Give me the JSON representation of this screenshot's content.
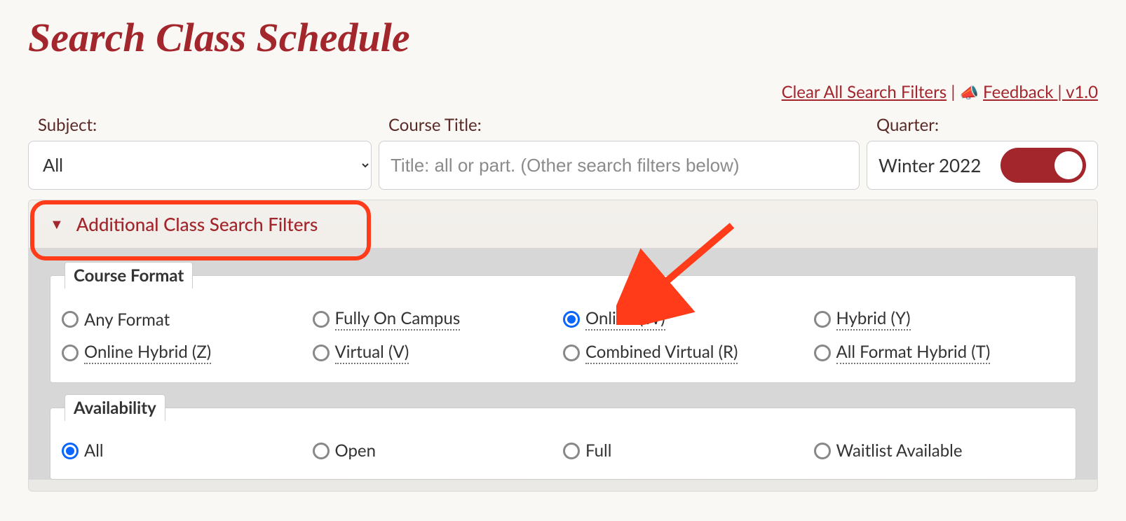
{
  "header": {
    "title": "Search Class Schedule"
  },
  "links": {
    "clear": "Clear All Search Filters",
    "sep": " | ",
    "feedback": "Feedback | v1.0"
  },
  "fields": {
    "subject_label": "Subject:",
    "subject_value": "All",
    "course_title_label": "Course Title:",
    "course_title_placeholder": "Title: all or part. (Other search filters below)",
    "quarter_label": "Quarter:",
    "quarter_value": "Winter 2022"
  },
  "accordion": {
    "label": "Additional Class Search Filters"
  },
  "course_format": {
    "legend": "Course Format",
    "options": [
      {
        "label": "Any Format",
        "dotted": false,
        "checked": false
      },
      {
        "label": "Fully On Campus",
        "dotted": true,
        "checked": false
      },
      {
        "label": "Online (W)",
        "dotted": true,
        "checked": true
      },
      {
        "label": "Hybrid (Y)",
        "dotted": true,
        "checked": false
      },
      {
        "label": "Online Hybrid (Z)",
        "dotted": true,
        "checked": false
      },
      {
        "label": "Virtual (V)",
        "dotted": true,
        "checked": false
      },
      {
        "label": "Combined Virtual (R)",
        "dotted": true,
        "checked": false
      },
      {
        "label": "All Format Hybrid (T)",
        "dotted": true,
        "checked": false
      }
    ]
  },
  "availability": {
    "legend": "Availability",
    "options": [
      {
        "label": "All",
        "checked": true
      },
      {
        "label": "Open",
        "checked": false
      },
      {
        "label": "Full",
        "checked": false
      },
      {
        "label": "Waitlist Available",
        "checked": false
      }
    ]
  }
}
